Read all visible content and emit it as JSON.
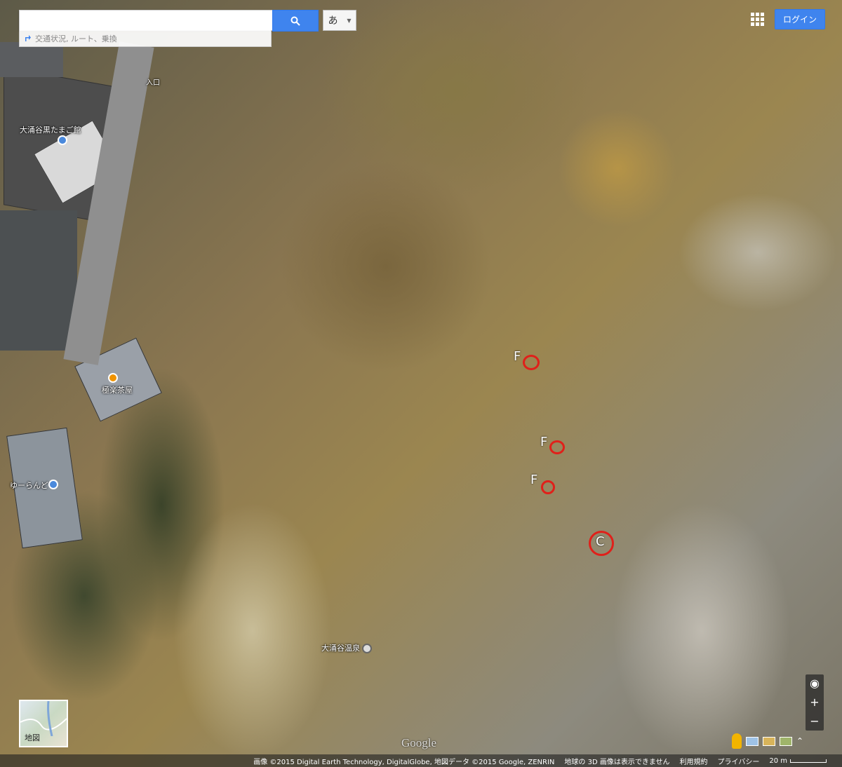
{
  "search": {
    "placeholder": "",
    "button_icon": "search-icon",
    "ime_label": "あ",
    "directions_label": "交通状況, ルート、乗換"
  },
  "header": {
    "login_label": "ログイン",
    "apps_icon": "grid-icon"
  },
  "pois": [
    {
      "label": "大涌谷黒たまご館",
      "icon": "shopping-bag-icon"
    },
    {
      "label": "極楽茶屋",
      "icon": "food-icon"
    },
    {
      "label": "ゆーらんど",
      "icon": "shopping-bag-icon"
    },
    {
      "label": "大涌谷温泉",
      "icon": "hot-spring-icon"
    },
    {
      "label": "入口",
      "icon": "entrance-icon"
    }
  ],
  "markers": [
    {
      "letter": "F"
    },
    {
      "letter": "F"
    },
    {
      "letter": "F"
    },
    {
      "letter": "C"
    }
  ],
  "map_type_toggle": {
    "label": "地図"
  },
  "zoom": {
    "plus": "+",
    "minus": "−"
  },
  "attribution": {
    "imagery": "画像 ©2015 Digital Earth Technology, DigitalGlobe, 地図データ ©2015 Google, ZENRIN",
    "notice": "地球の 3D 画像は表示できません",
    "terms": "利用規約",
    "privacy": "プライバシー",
    "scale": "20 m"
  },
  "logo": "Google",
  "colors": {
    "accent": "#3f84ee",
    "marker": "#e0201a"
  }
}
